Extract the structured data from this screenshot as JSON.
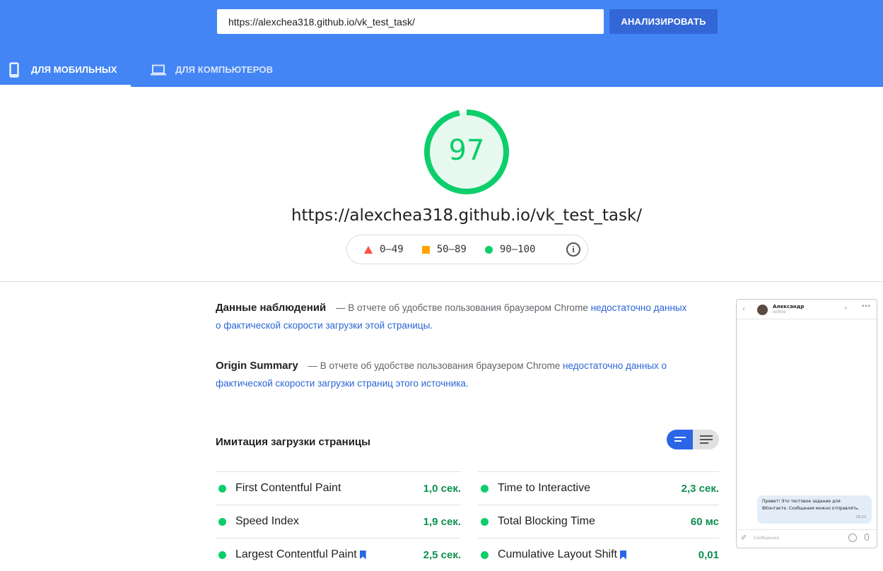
{
  "header": {
    "url_value": "https://alexchea318.github.io/vk_test_task/",
    "analyze_label": "АНАЛИЗИРОВАТЬ",
    "tabs": [
      {
        "label": "ДЛЯ МОБИЛЬНЫХ",
        "icon": "smartphone-icon",
        "active": true
      },
      {
        "label": "ДЛЯ КОМПЬЮТЕРОВ",
        "icon": "laptop-icon",
        "active": false
      }
    ],
    "accent_color": "#4385f5"
  },
  "score": {
    "value": "97",
    "fraction": 0.97,
    "color": "#0cce6b",
    "final_url": "https://alexchea318.github.io/vk_test_task/",
    "legend": [
      {
        "range": "0–49",
        "shape": "triangle",
        "color": "#ff4e42"
      },
      {
        "range": "50–89",
        "shape": "square",
        "color": "#ffa400"
      },
      {
        "range": "90–100",
        "shape": "circle",
        "color": "#0cce6b"
      }
    ],
    "info_icon": "info-icon"
  },
  "field_data": {
    "title": "Данные наблюдений",
    "text": "— В отчете об удобстве пользования браузером Chrome",
    "link": "недостаточно данных о фактической скорости загрузки этой страницы."
  },
  "origin_summary": {
    "title": "Origin Summary",
    "text": "— В отчете об удобстве пользования браузером Chrome",
    "link": "недостаточно данных о фактической скорости загрузки страниц этого источника."
  },
  "lab": {
    "title": "Имитация загрузки страницы",
    "metrics": [
      {
        "name": "First Contentful Paint",
        "value": "1,0 сек.",
        "bookmark": false
      },
      {
        "name": "Time to Interactive",
        "value": "2,3 сек.",
        "bookmark": false
      },
      {
        "name": "Speed Index",
        "value": "1,9 сек.",
        "bookmark": false
      },
      {
        "name": "Total Blocking Time",
        "value": "60 мс",
        "bookmark": false
      },
      {
        "name": "Largest Contentful Paint",
        "value": "2,5 сек.",
        "bookmark": true
      },
      {
        "name": "Cumulative Layout Shift",
        "value": "0,01",
        "bookmark": true
      }
    ]
  },
  "thumbnail": {
    "user_name": "Александр",
    "user_status": "online",
    "message": "Привет! Это тестовое задание для ВКонтакте. Сообщения можно отправлять.",
    "message_time": "19:23",
    "input_placeholder": "Сообщение"
  }
}
